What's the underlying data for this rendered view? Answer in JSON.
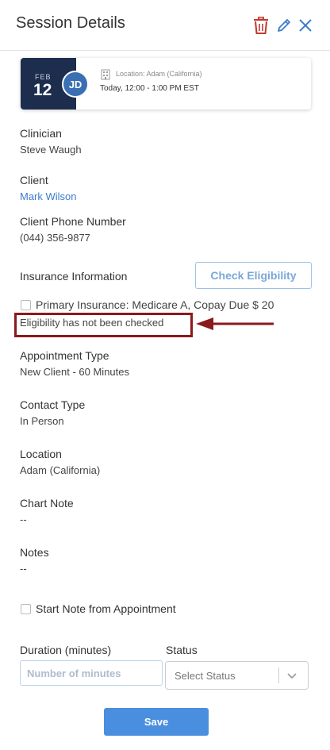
{
  "header": {
    "title": "Session Details",
    "delete_icon": "trash-icon",
    "edit_icon": "pencil-icon",
    "close_icon": "close-icon",
    "accent_color": "#c0392b",
    "icon_color": "#3c7dcb"
  },
  "appointment_card": {
    "month": "FEB",
    "day": "12",
    "avatar_initials": "JD",
    "location_line": "Location: Adam (California)",
    "time_line": "Today, 12:00 - 1:00 PM EST",
    "date_color": "#1d2d4e"
  },
  "fields": {
    "clinician_label": "Clinician",
    "clinician_value": "Steve Waugh",
    "client_label": "Client",
    "client_value": "Mark Wilson",
    "phone_label": "Client Phone Number",
    "phone_value": "(044) 356-9877",
    "insurance_label": "Insurance Information",
    "check_eligibility_label": "Check Eligibility",
    "primary_insurance_text": "Primary Insurance: Medicare A, Copay Due $ 20",
    "eligibility_status": "Eligibility has not been checked",
    "appointment_type_label": "Appointment Type",
    "appointment_type_value": "New Client - 60 Minutes",
    "contact_type_label": "Contact Type",
    "contact_type_value": "In Person",
    "location_label": "Location",
    "location_value": "Adam (California)",
    "chart_note_label": "Chart Note",
    "chart_note_value": "--",
    "notes_label": "Notes",
    "notes_value": "--",
    "start_note_label": "Start Note from Appointment"
  },
  "form": {
    "duration_label": "Duration (minutes)",
    "duration_placeholder": "Number of minutes",
    "status_label": "Status",
    "status_value": "Select Status",
    "save_label": "Save"
  },
  "annotation": {
    "highlight_color": "#8b1a1a"
  }
}
